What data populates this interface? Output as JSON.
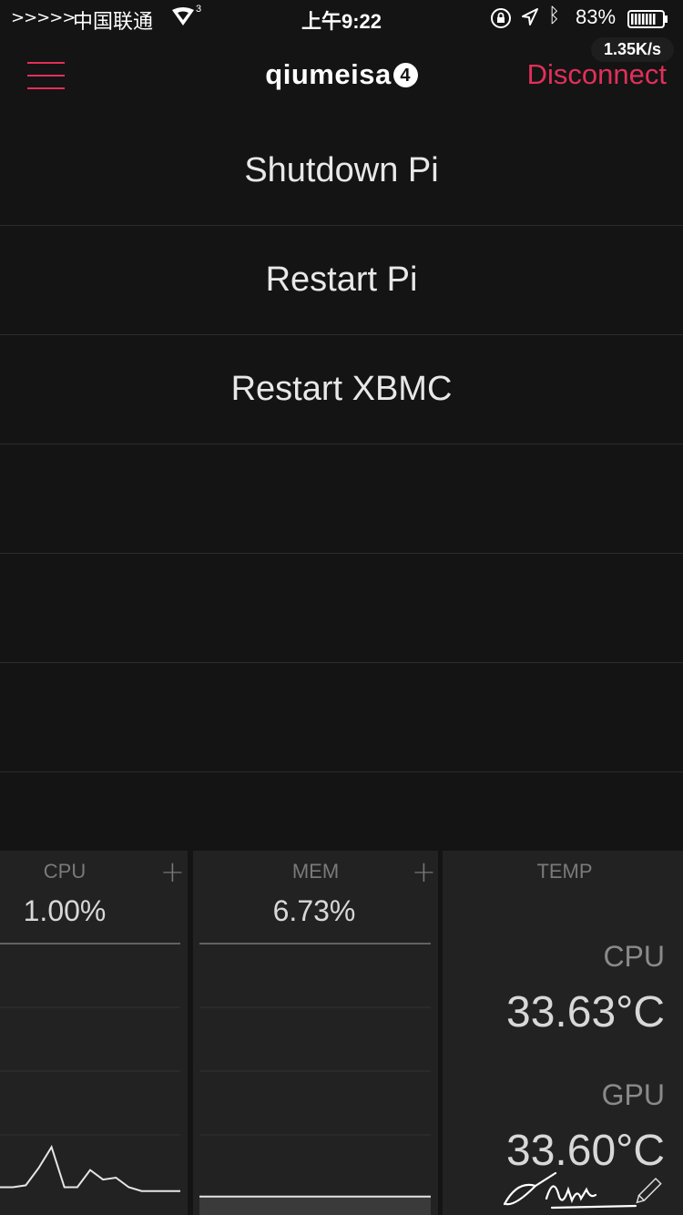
{
  "status_bar": {
    "signal": ">>>>>",
    "carrier": "中国联通",
    "network_sup": "3",
    "time": "上午9:22",
    "battery_percent": "83%",
    "battery_level": 0.83
  },
  "nav": {
    "title": "qiumeisa",
    "title_badge": "4",
    "disconnect_label": "Disconnect",
    "speed": "1.35K/s",
    "accent_color": "#e0305a"
  },
  "actions": [
    {
      "label": "Shutdown Pi"
    },
    {
      "label": "Restart Pi"
    },
    {
      "label": "Restart XBMC"
    },
    {
      "label": ""
    },
    {
      "label": ""
    },
    {
      "label": ""
    }
  ],
  "panels": {
    "cpu": {
      "label": "CPU",
      "plus": "+",
      "value": "1.00%",
      "series": [
        1.0,
        1.0,
        1.2,
        3.0,
        5.2,
        1.0,
        1.0,
        2.8,
        1.8,
        2.0,
        1.0,
        0.6,
        0.6,
        0.6,
        0.6
      ]
    },
    "mem": {
      "label": "MEM",
      "plus": "+",
      "value": "6.73%",
      "series": [
        6.73,
        6.73,
        6.73,
        6.73,
        6.73,
        6.73,
        6.73,
        6.73,
        6.73,
        6.73
      ]
    },
    "temp": {
      "label": "TEMP",
      "cpu_label": "CPU",
      "cpu_value": "33.63°C",
      "gpu_label": "GPU",
      "gpu_value": "33.60°C"
    }
  }
}
